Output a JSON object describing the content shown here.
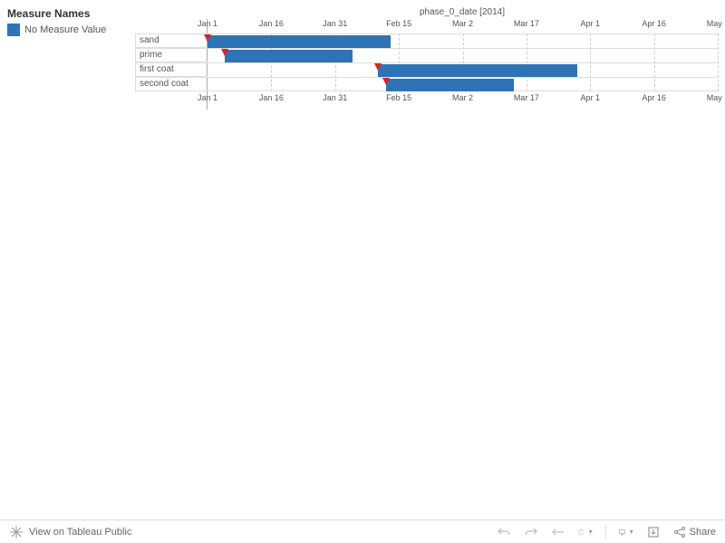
{
  "legend": {
    "title": "Measure Names",
    "item": "No Measure Value"
  },
  "axis_title": "phase_0_date [2014]",
  "ticks": [
    "Jan 1",
    "Jan 16",
    "Jan 31",
    "Feb 15",
    "Mar 2",
    "Mar 17",
    "Apr 1",
    "Apr 16",
    "May 1"
  ],
  "rows": [
    "sand",
    "prime",
    "first coat",
    "second coat"
  ],
  "toolbar": {
    "view_label": "View on Tableau Public",
    "share_label": "Share"
  },
  "chart_data": {
    "type": "bar",
    "title": "phase_0_date [2014]",
    "xlabel": "phase_0_date [2014]",
    "ylabel": "",
    "x_range": [
      "2014-01-01",
      "2014-05-01"
    ],
    "categories": [
      "sand",
      "prime",
      "first coat",
      "second coat"
    ],
    "series": [
      {
        "name": "sand",
        "start": "2014-01-01",
        "end": "2014-02-13",
        "marker": "2014-01-01"
      },
      {
        "name": "prime",
        "start": "2014-01-05",
        "end": "2014-02-04",
        "marker": "2014-01-05"
      },
      {
        "name": "first coat",
        "start": "2014-02-10",
        "end": "2014-03-29",
        "marker": "2014-02-10"
      },
      {
        "name": "second coat",
        "start": "2014-02-12",
        "end": "2014-03-14",
        "marker": "2014-02-12"
      }
    ],
    "colors": {
      "bar": "#2e73b5",
      "marker": "#d62728"
    }
  }
}
